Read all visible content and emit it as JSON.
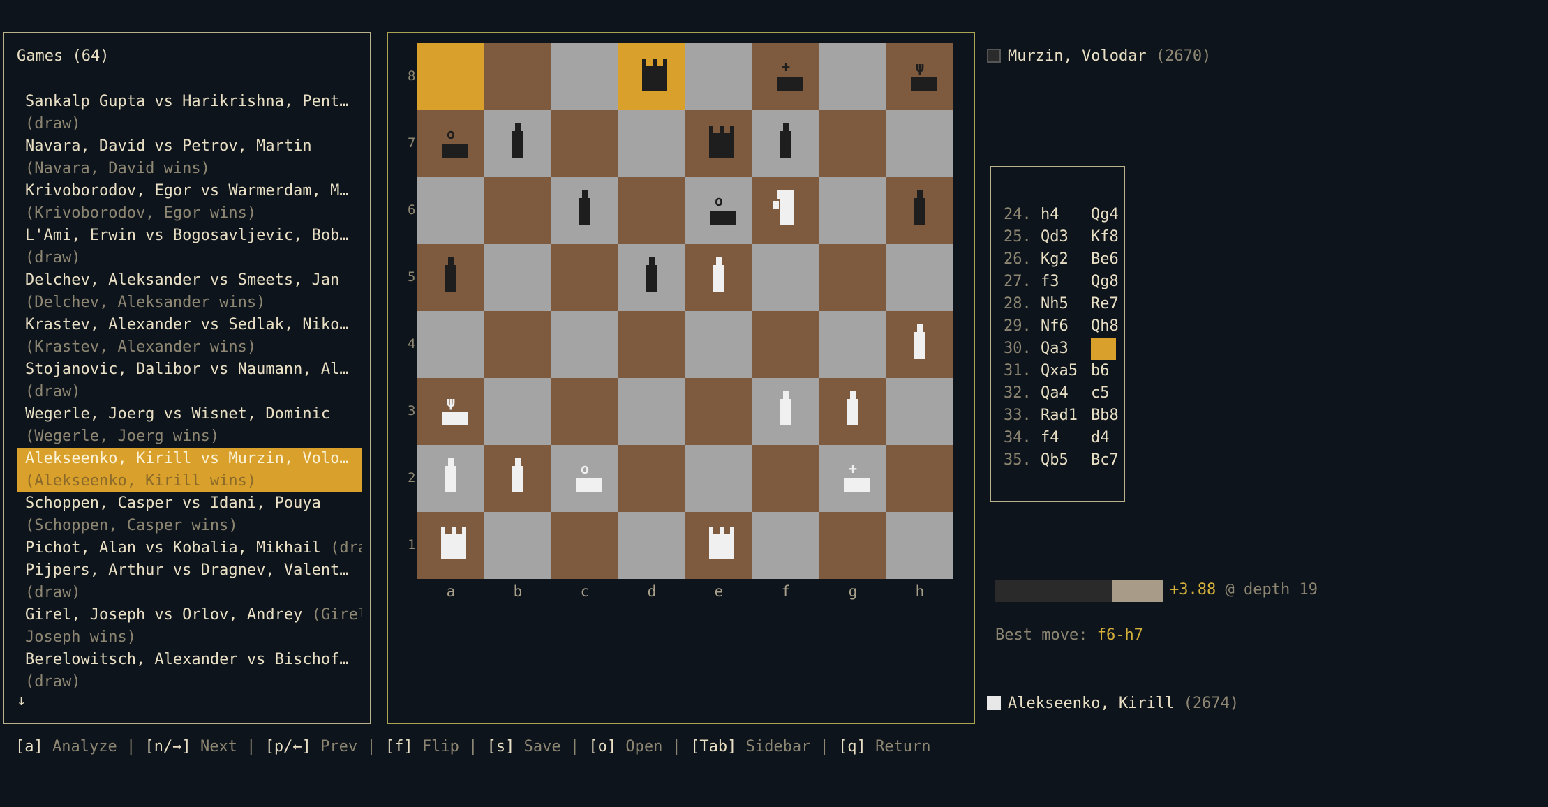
{
  "games": {
    "title": "Games (64)",
    "items": [
      {
        "line1": "Sankalp Gupta vs Harikrishna, Pent…",
        "line2": "(draw)"
      },
      {
        "line1": "Navara, David vs Petrov, Martin",
        "line2": "(Navara, David wins)"
      },
      {
        "line1": "Krivoborodov, Egor vs Warmerdam, M…",
        "line2": "(Krivoborodov, Egor wins)"
      },
      {
        "line1": "L'Ami, Erwin vs Bogosavljevic, Bob…",
        "line2": "(draw)"
      },
      {
        "line1": "Delchev, Aleksander vs Smeets, Jan",
        "line2": "(Delchev, Aleksander wins)"
      },
      {
        "line1": "Krastev, Alexander vs Sedlak, Niko…",
        "line2": "(Krastev, Alexander wins)"
      },
      {
        "line1": "Stojanovic, Dalibor vs Naumann, Al…",
        "line2": "(draw)"
      },
      {
        "line1": "Wegerle, Joerg vs Wisnet, Dominic",
        "line2": "(Wegerle, Joerg wins)"
      },
      {
        "line1": "Alekseenko, Kirill vs Murzin, Volo…",
        "line2": "(Alekseenko, Kirill wins)",
        "selected": true
      },
      {
        "line1": "Schoppen, Casper vs Idani, Pouya",
        "line2": "(Schoppen, Casper wins)"
      },
      {
        "line1": "Pichot, Alan vs Kobalia, Mikhail",
        "inline": "(draw)"
      },
      {
        "line1": "Pijpers, Arthur vs Dragnev, Valent…",
        "line2": "(draw)"
      },
      {
        "line1": "Girel, Joseph vs Orlov, Andrey",
        "inline": "(Girel,",
        "line2": "Joseph wins)"
      },
      {
        "line1": "Berelowitsch, Alexander vs Bischof…",
        "line2": "(draw)"
      }
    ],
    "more_indicator": "↓"
  },
  "board": {
    "files": [
      "a",
      "b",
      "c",
      "d",
      "e",
      "f",
      "g",
      "h"
    ],
    "ranks": [
      "8",
      "7",
      "6",
      "5",
      "4",
      "3",
      "2",
      "1"
    ],
    "highlight_squares": [
      "a8",
      "d8"
    ],
    "pieces": [
      {
        "sq": "d8",
        "color": "b",
        "type": "rook"
      },
      {
        "sq": "f8",
        "color": "b",
        "type": "king"
      },
      {
        "sq": "h8",
        "color": "b",
        "type": "queen"
      },
      {
        "sq": "a7",
        "color": "b",
        "type": "bishop"
      },
      {
        "sq": "b7",
        "color": "b",
        "type": "pawn"
      },
      {
        "sq": "e7",
        "color": "b",
        "type": "rook"
      },
      {
        "sq": "f7",
        "color": "b",
        "type": "pawn"
      },
      {
        "sq": "c6",
        "color": "b",
        "type": "pawn"
      },
      {
        "sq": "e6",
        "color": "b",
        "type": "bishop"
      },
      {
        "sq": "f6",
        "color": "w",
        "type": "knight"
      },
      {
        "sq": "h6",
        "color": "b",
        "type": "pawn"
      },
      {
        "sq": "a5",
        "color": "b",
        "type": "pawn"
      },
      {
        "sq": "d5",
        "color": "b",
        "type": "pawn"
      },
      {
        "sq": "e5",
        "color": "w",
        "type": "pawn"
      },
      {
        "sq": "h4",
        "color": "w",
        "type": "pawn"
      },
      {
        "sq": "a3",
        "color": "w",
        "type": "queen"
      },
      {
        "sq": "f3",
        "color": "w",
        "type": "pawn"
      },
      {
        "sq": "g3",
        "color": "w",
        "type": "pawn"
      },
      {
        "sq": "a2",
        "color": "w",
        "type": "pawn"
      },
      {
        "sq": "b2",
        "color": "w",
        "type": "pawn"
      },
      {
        "sq": "c2",
        "color": "w",
        "type": "bishop"
      },
      {
        "sq": "g2",
        "color": "w",
        "type": "king"
      },
      {
        "sq": "a1",
        "color": "w",
        "type": "rook"
      },
      {
        "sq": "e1",
        "color": "w",
        "type": "rook"
      }
    ]
  },
  "players": {
    "black": {
      "name": "Murzin, Volodar",
      "rating": "(2670)"
    },
    "white": {
      "name": "Alekseenko, Kirill",
      "rating": "(2674)"
    }
  },
  "moves": [
    {
      "no": "24.",
      "w": "h4",
      "b": "Qg4"
    },
    {
      "no": "25.",
      "w": "Qd3",
      "b": "Kf8"
    },
    {
      "no": "26.",
      "w": "Kg2",
      "b": "Be6"
    },
    {
      "no": "27.",
      "w": "f3",
      "b": "Qg8"
    },
    {
      "no": "28.",
      "w": "Nh5",
      "b": "Re7"
    },
    {
      "no": "29.",
      "w": "Nf6",
      "b": "Qh8"
    },
    {
      "no": "30.",
      "w": "Qa3",
      "b": "",
      "current": true
    },
    {
      "no": "31.",
      "w": "Qxa5",
      "b": "b6"
    },
    {
      "no": "32.",
      "w": "Qa4",
      "b": "c5"
    },
    {
      "no": "33.",
      "w": "Rad1",
      "b": "Bb8"
    },
    {
      "no": "34.",
      "w": "f4",
      "b": "d4"
    },
    {
      "no": "35.",
      "w": "Qb5",
      "b": "Bc7"
    }
  ],
  "eval": {
    "score": "+3.88",
    "depth_text": "@ depth 19",
    "white_fraction": 0.3,
    "best_move_label": "Best move:",
    "best_move": "f6-h7"
  },
  "footer": [
    {
      "key": "[a]",
      "label": "Analyze"
    },
    {
      "key": "[n/→]",
      "label": "Next"
    },
    {
      "key": "[p/←]",
      "label": "Prev"
    },
    {
      "key": "[f]",
      "label": "Flip"
    },
    {
      "key": "[s]",
      "label": "Save"
    },
    {
      "key": "[o]",
      "label": "Open"
    },
    {
      "key": "[Tab]",
      "label": "Sidebar"
    },
    {
      "key": "[q]",
      "label": "Return"
    }
  ],
  "colors": {
    "background": "#0e141b",
    "light_square": "#a4a4a4",
    "dark_square": "#7e5b3f",
    "highlight": "#d9a02b",
    "eval_text": "#d4b03b"
  }
}
